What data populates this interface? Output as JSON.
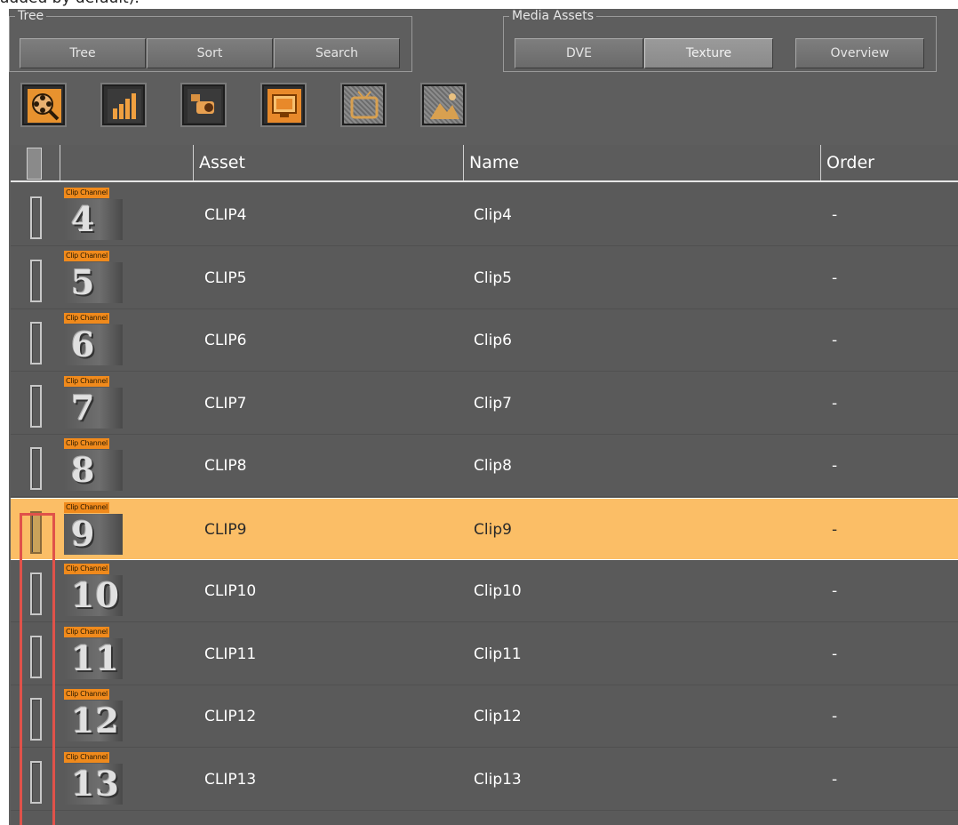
{
  "caption": "added by default).",
  "tree_group": {
    "title": "Tree",
    "buttons": [
      "Tree",
      "Sort",
      "Search"
    ]
  },
  "media_group": {
    "title": "Media Assets",
    "buttons": [
      "DVE",
      "Texture"
    ],
    "active": "Texture",
    "overview": "Overview"
  },
  "toolbar": {
    "icons": [
      "film-reel-search-icon",
      "bar-chart-icon",
      "camera-icon",
      "monitor-icon",
      "tv-icon",
      "image-icon"
    ]
  },
  "table": {
    "headers": {
      "asset": "Asset",
      "name": "Name",
      "order": "Order"
    },
    "badge": "Clip Channel",
    "rows": [
      {
        "num": "4",
        "asset": "CLIP4",
        "name": "Clip4",
        "order": "-"
      },
      {
        "num": "5",
        "asset": "CLIP5",
        "name": "Clip5",
        "order": "-"
      },
      {
        "num": "6",
        "asset": "CLIP6",
        "name": "Clip6",
        "order": "-"
      },
      {
        "num": "7",
        "asset": "CLIP7",
        "name": "Clip7",
        "order": "-"
      },
      {
        "num": "8",
        "asset": "CLIP8",
        "name": "Clip8",
        "order": "-"
      },
      {
        "num": "9",
        "asset": "CLIP9",
        "name": "Clip9",
        "order": "-",
        "selected": true
      },
      {
        "num": "10",
        "asset": "CLIP10",
        "name": "Clip10",
        "order": "-"
      },
      {
        "num": "11",
        "asset": "CLIP11",
        "name": "Clip11",
        "order": "-"
      },
      {
        "num": "12",
        "asset": "CLIP12",
        "name": "Clip12",
        "order": "-"
      },
      {
        "num": "13",
        "asset": "CLIP13",
        "name": "Clip13",
        "order": "-"
      }
    ]
  },
  "colors": {
    "background": "#5e5e5e",
    "selected_row": "#fbbe66",
    "badge": "#f08a1c",
    "highlight_outline": "#e0524a"
  }
}
